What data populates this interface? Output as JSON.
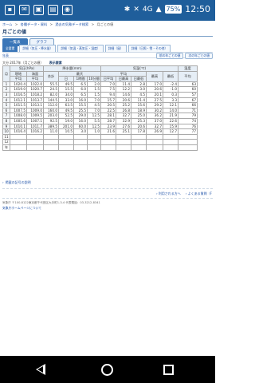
{
  "status": {
    "battery": "75%",
    "time": "12:50",
    "signal": "4G"
  },
  "breadcrumb": [
    "ホーム",
    ">",
    "各種データ・資料",
    ">",
    "過去の気象データ検索",
    ">",
    "月ごとの値"
  ],
  "page_title": "月ごとの値",
  "tabs": [
    "一覧表",
    "グラフ"
  ],
  "subtabs": [
    "全要素",
    "詳細（気圧・降水量）",
    "詳細（気温・蒸気圧・湿度）",
    "詳細（風）",
    "詳細（日照・雪・その他）"
  ],
  "subnav": {
    "left": "年表",
    "prev": "前の年ごとの値",
    "next": "次の年ごとの値"
  },
  "caption": {
    "place": "大分",
    "year": "2017年（月ごとの値）",
    "section": "表示要素"
  },
  "table": {
    "header1": [
      "月",
      "気圧(hPa)",
      "降水量(mm)",
      "気温(℃)",
      "湿度"
    ],
    "header2": [
      "現地",
      "海面",
      "合計",
      "最大",
      "平均",
      "最高",
      "最低"
    ],
    "header3": [
      "平均",
      "平均",
      "日",
      "1時間",
      "10分間",
      "日平均",
      "日最高",
      "日最低",
      "最高",
      "最低",
      "平均"
    ],
    "rows": [
      [
        "1",
        "1020.4",
        "1022.0",
        "55.5",
        "49.5",
        "6.5",
        "2.0",
        "7.0",
        "11.4",
        "2.8",
        "17.0",
        "-2.4",
        "63"
      ],
      [
        "2",
        "1019.0",
        "1020.7",
        "24.5",
        "15.5",
        "6.0",
        "1.5",
        "7.5",
        "12.2",
        "3.0",
        "20.6",
        "-1.0",
        "60"
      ],
      [
        "3",
        "1016.5",
        "1018.2",
        "82.0",
        "34.0",
        "6.5",
        "1.5",
        "9.4",
        "14.6",
        "4.5",
        "20.1",
        "0.3",
        "57"
      ],
      [
        "4",
        "1012.1",
        "1013.7",
        "144.5",
        "33.0",
        "16.0",
        "7.0",
        "15.7",
        "20.6",
        "11.4",
        "27.5",
        "3.3",
        "67"
      ],
      [
        "5",
        "1011.5",
        "1013.1",
        "112.0",
        "63.5",
        "15.5",
        "4.5",
        "20.5",
        "25.2",
        "15.6",
        "29.2",
        "12.1",
        "66"
      ],
      [
        "6",
        "1007.5",
        "1009.0",
        "160.0",
        "49.5",
        "25.5",
        "7.0",
        "22.5",
        "26.8",
        "18.9",
        "30.2",
        "14.0",
        "71"
      ],
      [
        "7",
        "1008.0",
        "1009.5",
        "203.0",
        "52.5",
        "29.0",
        "12.5",
        "28.1",
        "32.7",
        "25.0",
        "36.2",
        "21.9",
        "79"
      ],
      [
        "8",
        "1005.6",
        "1007.1",
        "92.5",
        "19.0",
        "16.0",
        "5.5",
        "28.7",
        "32.9",
        "25.3",
        "37.0",
        "22.6",
        "74"
      ],
      [
        "9",
        "1010.1",
        "1011.7",
        "389.5",
        "201.0",
        "60.0",
        "12.5",
        "23.9",
        "27.6",
        "20.6",
        "32.7",
        "15.9",
        "76"
      ],
      [
        "10",
        "1016.4",
        "1016.2",
        "11.0",
        "10.5",
        "3.0",
        "1.0",
        "21.6",
        "25.1",
        "17.8",
        "26.9",
        "12.7",
        "77"
      ],
      [
        "11",
        "",
        "",
        "",
        "",
        "",
        "",
        "",
        "",
        "",
        "",
        "",
        ""
      ],
      [
        "12",
        "",
        "",
        "",
        "",
        "",
        "",
        "",
        "",
        "",
        "",
        "",
        ""
      ],
      [
        "年",
        "",
        "",
        "",
        "",
        "",
        "",
        "",
        "",
        "",
        "",
        "",
        ""
      ]
    ]
  },
  "links": {
    "note": "掲載の記号の説明",
    "usage": "利用される方へ",
    "faq": "よくある質問（F"
  },
  "footer": {
    "address": "気象庁 〒100-8122東京都千代田区大手町1-3-4 代表電話：03-3212-8341",
    "home": "気象庁ホームページについて"
  }
}
